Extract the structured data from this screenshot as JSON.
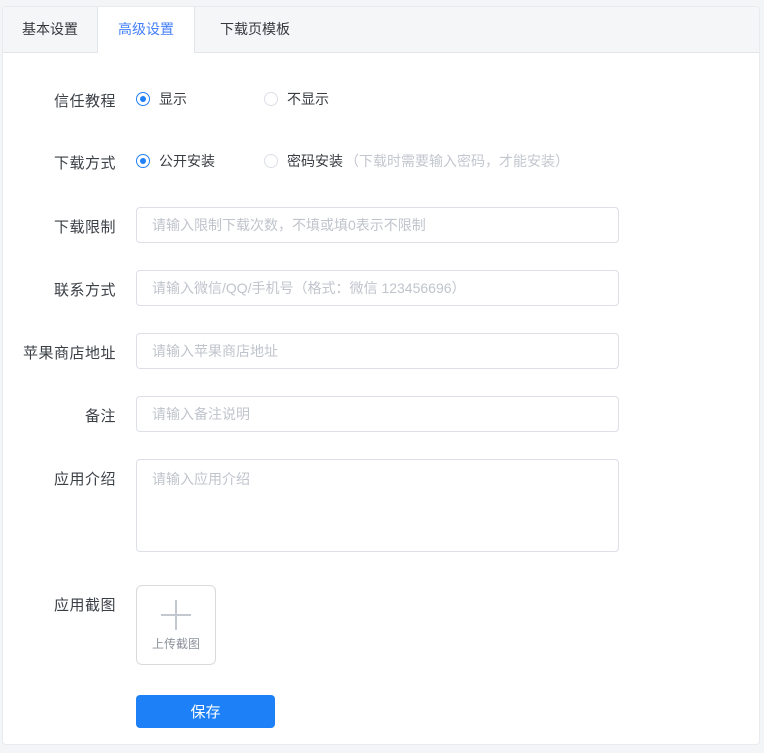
{
  "tabs": [
    {
      "label": "基本设置",
      "active": false
    },
    {
      "label": "高级设置",
      "active": true
    },
    {
      "label": "下载页模板",
      "active": false
    }
  ],
  "form": {
    "trust_tutorial": {
      "label": "信任教程",
      "options": [
        {
          "label": "显示",
          "selected": true
        },
        {
          "label": "不显示",
          "selected": false
        }
      ]
    },
    "download_method": {
      "label": "下载方式",
      "options": [
        {
          "label": "公开安装",
          "selected": true
        },
        {
          "label": "密码安装",
          "selected": false
        }
      ],
      "hint": "（下载时需要输入密码，才能安装）"
    },
    "download_limit": {
      "label": "下载限制",
      "placeholder": "请输入限制下载次数，不填或填0表示不限制",
      "value": ""
    },
    "contact": {
      "label": "联系方式",
      "placeholder": "请输入微信/QQ/手机号（格式：微信 123456696）",
      "value": ""
    },
    "appstore_url": {
      "label": "苹果商店地址",
      "placeholder": "请输入苹果商店地址",
      "value": ""
    },
    "remark": {
      "label": "备注",
      "placeholder": "请输入备注说明",
      "value": ""
    },
    "app_intro": {
      "label": "应用介绍",
      "placeholder": "请输入应用介绍",
      "value": ""
    },
    "screenshot": {
      "label": "应用截图",
      "upload_text": "上传截图"
    },
    "save_label": "保存"
  },
  "colors": {
    "primary": "#2080f7",
    "save_button_bg": "#1e80f6",
    "tab_active_text": "#447ffa",
    "tabbar_bg": "#f5f6f8",
    "input_border": "#dcdfe6",
    "placeholder_text": "#c0c4cc"
  }
}
